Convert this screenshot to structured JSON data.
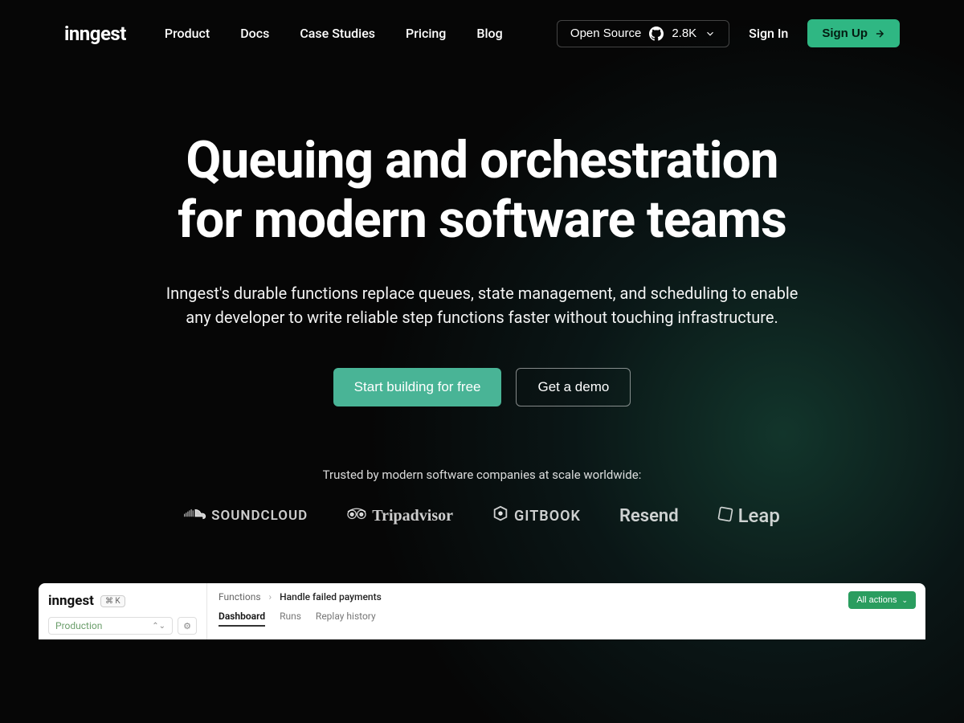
{
  "header": {
    "logo": "inngest",
    "nav": [
      "Product",
      "Docs",
      "Case Studies",
      "Pricing",
      "Blog"
    ],
    "open_source": {
      "label": "Open Source",
      "stars": "2.8K"
    },
    "signin": "Sign In",
    "signup": "Sign Up"
  },
  "hero": {
    "title_line1": "Queuing and orchestration",
    "title_line2": "for modern software teams",
    "subtitle": "Inngest's durable functions replace queues, state management, and scheduling to enable any developer to write reliable step functions faster without touching infrastructure.",
    "primary_cta": "Start building for free",
    "secondary_cta": "Get a demo",
    "trusted_text": "Trusted by modern software companies at scale worldwide:",
    "companies": [
      "SOUNDCLOUD",
      "Tripadvisor",
      "GITBOOK",
      "Resend",
      "Leap"
    ]
  },
  "dashboard": {
    "logo": "inngest",
    "kbd": "⌘ K",
    "env_select": "Production",
    "breadcrumb": {
      "root": "Functions",
      "current": "Handle failed payments"
    },
    "tabs": [
      "Dashboard",
      "Runs",
      "Replay history"
    ],
    "all_actions": "All actions"
  }
}
